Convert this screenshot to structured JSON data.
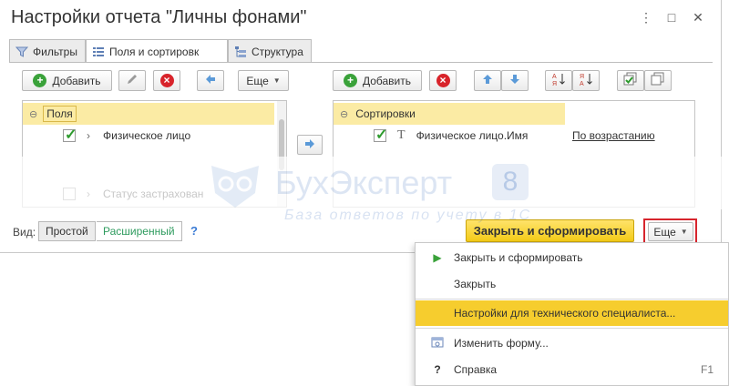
{
  "window": {
    "title": "Настройки отчета \"Личны    фонами\"",
    "buttons": {
      "more": "⋮",
      "maximize": "□",
      "close": "✕"
    }
  },
  "tabs": [
    {
      "label": "Фильтры",
      "icon": "filter-icon",
      "active": false
    },
    {
      "label": "Поля и сортировк",
      "icon": "fields-icon",
      "active": true
    },
    {
      "label": "Структура",
      "icon": "structure-icon",
      "active": false
    }
  ],
  "left_toolbar": {
    "add_label": "Добавить",
    "more_label": "Еще"
  },
  "right_toolbar": {
    "add_label": "Добавить"
  },
  "fields": {
    "group_label": "Поля",
    "items": [
      {
        "label": "Физическое лицо",
        "checked": true
      },
      {
        "label": "Статус застрахован",
        "checked": false
      }
    ]
  },
  "sorting": {
    "group_label": "Сортировки",
    "items": [
      {
        "label": "Физическое лицо.Имя",
        "direction": "По возрастанию",
        "checked": true
      }
    ]
  },
  "bottom": {
    "view_label": "Вид:",
    "simple_label": "Простой",
    "extended_label": "Расширенный",
    "help": "?",
    "primary_label": "Закрыть и сформировать",
    "more_label": "Еще"
  },
  "menu": {
    "items": [
      {
        "label": "Закрыть и сформировать",
        "icon": "play-icon",
        "shortcut": ""
      },
      {
        "label": "Закрыть",
        "icon": "",
        "shortcut": ""
      },
      {
        "label": "Настройки для технического специалиста...",
        "icon": "",
        "shortcut": ""
      },
      {
        "label": "Изменить форму...",
        "icon": "form-edit-icon",
        "shortcut": ""
      },
      {
        "label": "Справка",
        "icon": "help-icon",
        "shortcut": "F1"
      }
    ]
  },
  "watermark": {
    "title": "БухЭксперт",
    "number": "8",
    "subtitle": "База ответов по учету в 1С"
  },
  "colors": {
    "accent_yellow": "#f3cb18",
    "highlight": "#fbeba4",
    "menu_highlight": "#f6cd2e",
    "red_frame": "#d7252d",
    "green": "#3aa23a",
    "red": "#d8232a"
  }
}
